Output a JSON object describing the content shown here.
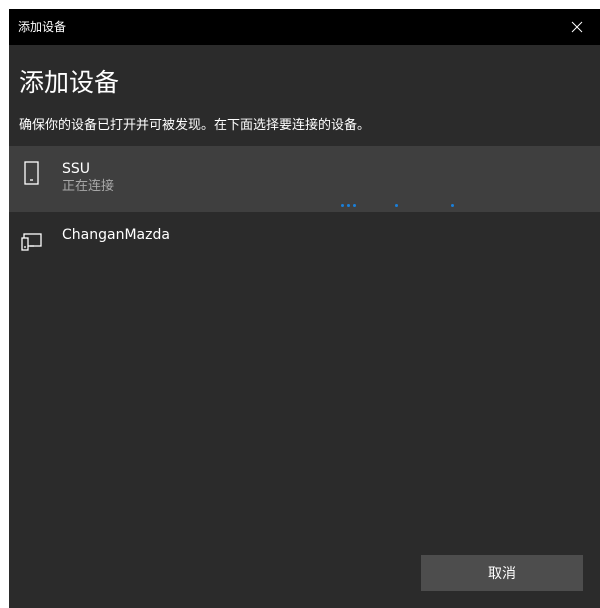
{
  "window": {
    "title": "添加设备"
  },
  "main": {
    "heading": "添加设备",
    "instructions": "确保你的设备已打开并可被发现。在下面选择要连接的设备。"
  },
  "devices": [
    {
      "name": "SSU",
      "status": "正在连接",
      "icon": "phone-icon",
      "selected": true
    },
    {
      "name": "ChanganMazda",
      "status": "",
      "icon": "display-device-icon",
      "selected": false
    }
  ],
  "footer": {
    "cancel_label": "取消"
  },
  "colors": {
    "background": "#2b2b2b",
    "titlebar": "#000000",
    "selected_row": "#3f3f3f",
    "accent": "#1a7fd9",
    "button": "#4d4d4d"
  }
}
